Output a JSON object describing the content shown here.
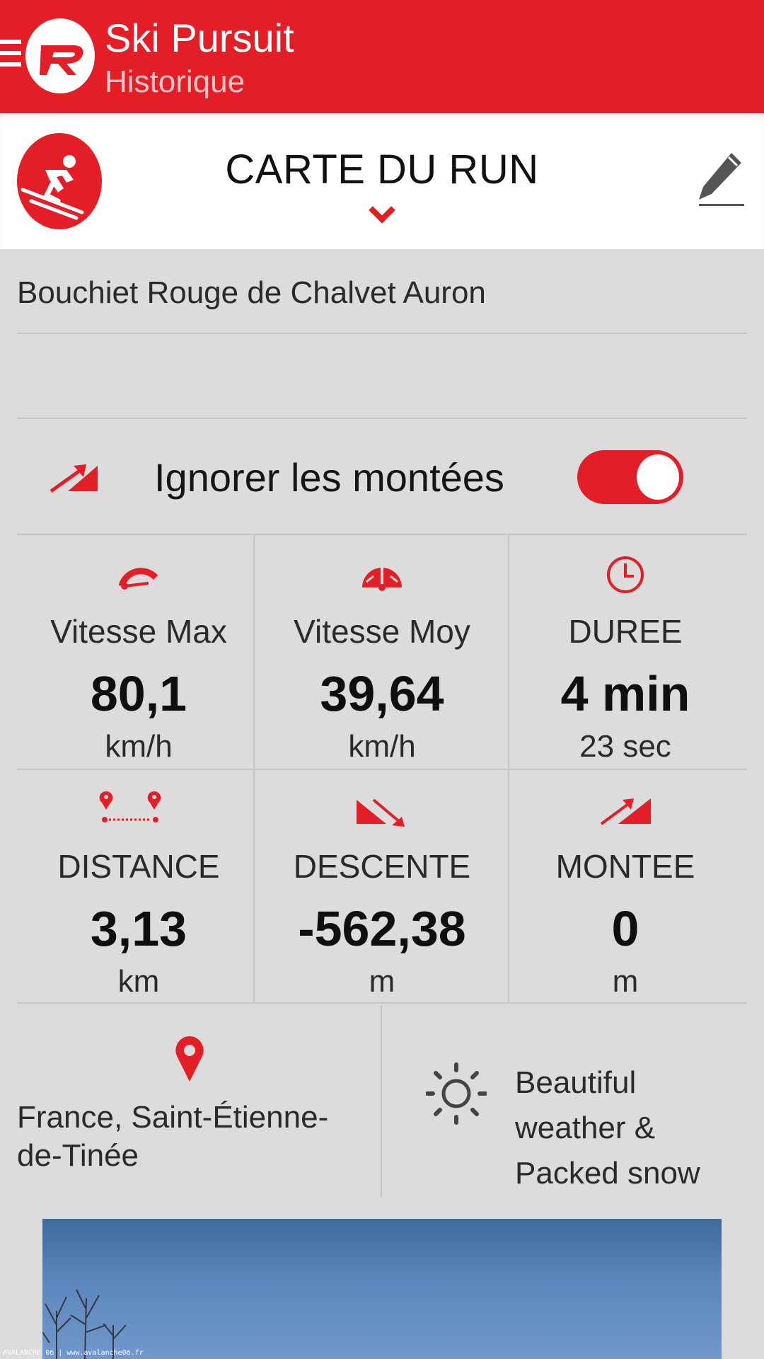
{
  "app": {
    "title": "Ski Pursuit",
    "subtitle": "Historique"
  },
  "header": {
    "title": "CARTE DU RUN"
  },
  "run": {
    "name": "Bouchiet Rouge de Chalvet Auron",
    "toggle_label": "Ignorer les montées",
    "toggle_on": true
  },
  "stats": [
    {
      "label": "Vitesse Max",
      "value": "80,1",
      "unit": "km/h",
      "icon": "speedometer-max-icon"
    },
    {
      "label": "Vitesse Moy",
      "value": "39,64",
      "unit": "km/h",
      "icon": "speedometer-avg-icon"
    },
    {
      "label": "DUREE",
      "value": "4 min",
      "unit": "23 sec",
      "icon": "clock-icon"
    },
    {
      "label": "DISTANCE",
      "value": "3,13",
      "unit": "km",
      "icon": "distance-pins-icon"
    },
    {
      "label": "DESCENTE",
      "value": "-562,38",
      "unit": "m",
      "icon": "descent-icon"
    },
    {
      "label": "MONTEE",
      "value": "0",
      "unit": "m",
      "icon": "climb-icon"
    }
  ],
  "location": "France, Saint-Étienne-de-Tinée",
  "weather": "Beautiful weather & Packed snow",
  "photo": {
    "caption": "AVALANCHE 06 | www.avalanche06.fr"
  },
  "colors": {
    "accent": "#e41e26",
    "background": "#dcdcdc",
    "header_bg": "#ffffff"
  }
}
